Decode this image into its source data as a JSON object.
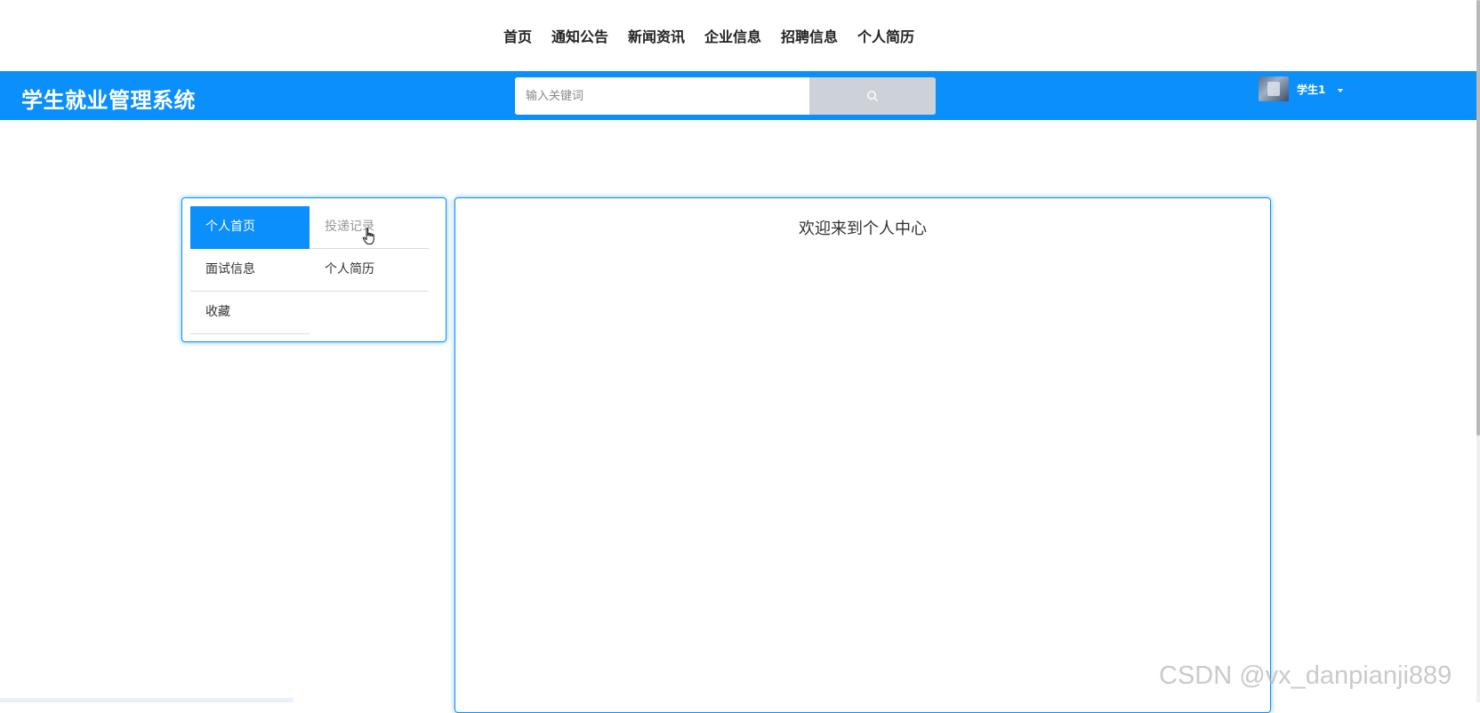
{
  "top_nav": {
    "items": [
      {
        "label": "首页"
      },
      {
        "label": "通知公告"
      },
      {
        "label": "新闻资讯"
      },
      {
        "label": "企业信息"
      },
      {
        "label": "招聘信息"
      },
      {
        "label": "个人简历"
      }
    ]
  },
  "header": {
    "brand": "学生就业管理系统",
    "search": {
      "placeholder": "输入关键词",
      "value": "",
      "button_icon": "search-icon"
    },
    "user": {
      "name": "学生1",
      "avatar_icon": "avatar-image",
      "caret_icon": "caret-down-icon"
    },
    "accent_color": "#0a8ffb"
  },
  "sidebar": {
    "items": [
      {
        "label": "个人首页",
        "state": "active"
      },
      {
        "label": "投递记录",
        "state": "hover"
      },
      {
        "label": "面试信息",
        "state": "normal"
      },
      {
        "label": "个人简历",
        "state": "normal"
      },
      {
        "label": "收藏",
        "state": "normal"
      }
    ]
  },
  "main": {
    "welcome_text": "欢迎来到个人中心"
  },
  "watermark": "CSDN @vx_danpianji889"
}
